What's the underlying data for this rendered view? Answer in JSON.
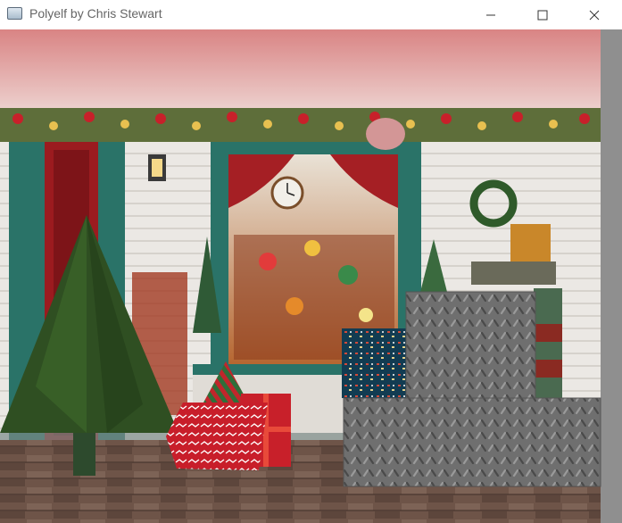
{
  "window": {
    "title": "Polyelf by Chris Stewart",
    "icon": "app-window-icon",
    "controls": [
      "minimize-icon",
      "maximize-icon",
      "close-icon"
    ]
  },
  "scene": {
    "background": "christmas-shop-porch-backdrop",
    "colors": {
      "porch_floor": "#6e5448",
      "wall_siding": "#e9e6e2",
      "teal_trim": "#2a7368",
      "curtain_red": "#a51f24",
      "sky_pink": "#d98a8a",
      "metal_plate": "#6d6d6d",
      "tree_green": "#2f4f22",
      "present_red": "#c8202a",
      "pink_ball": "#d39696",
      "navy_pattern": "#123c52"
    },
    "objects": [
      "large-pine-tree",
      "small-striped-tree",
      "red-present-box",
      "patterned-red-crate",
      "navy-patterned-crate",
      "metal-plate-block-tall",
      "metal-plate-block-wide",
      "pink-ball"
    ]
  }
}
